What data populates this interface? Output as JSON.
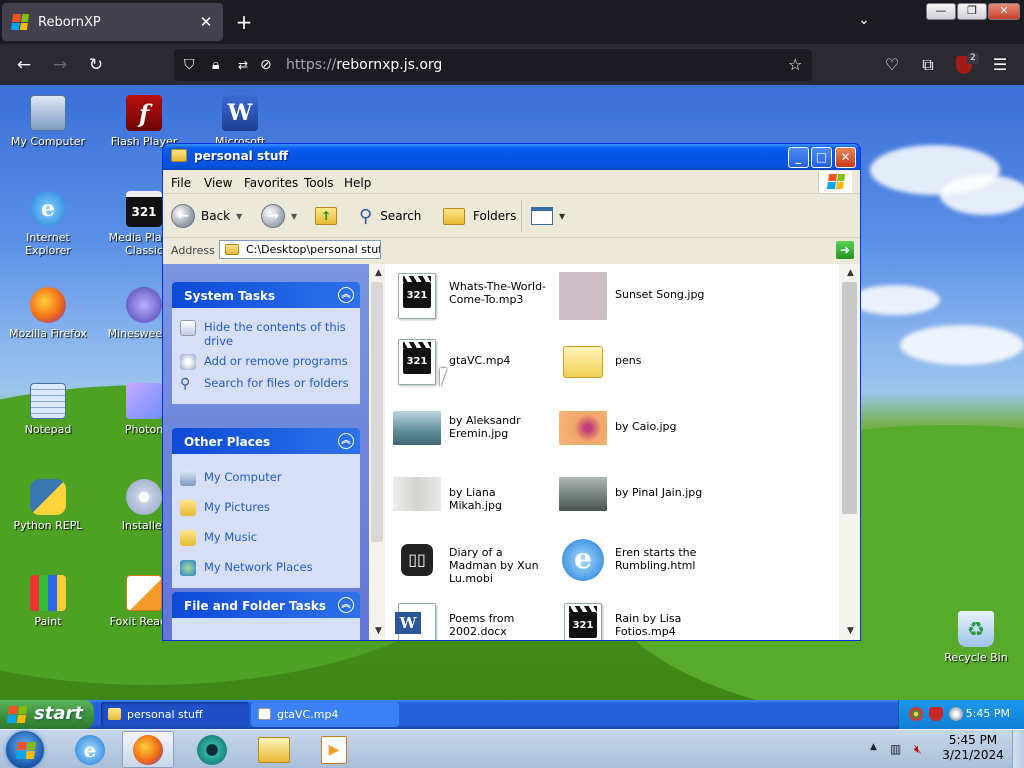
{
  "browser": {
    "tab_title": "RebornXP",
    "tab_close": "✕",
    "new_tab": "+",
    "tabs_list": "⌄",
    "window_controls": {
      "minimize": "—",
      "maximize": "❐",
      "close": "✕"
    },
    "url_protocol": "https://",
    "url_host": "rebornxp.js.org",
    "ublock_badge": "2",
    "icons": [
      "back-icon",
      "forward-icon",
      "reload-icon",
      "shield-icon",
      "lock-icon",
      "permissions-icon",
      "tracking-icon",
      "star-icon",
      "pocket-icon",
      "extensions-icon",
      "ublock-icon",
      "menu-icon"
    ]
  },
  "desktop": {
    "icons": [
      {
        "label": "My Computer",
        "icon": "computer-icon"
      },
      {
        "label": "Flash Player",
        "icon": "flash-icon"
      },
      {
        "label": "Microsoft",
        "icon": "word-icon"
      },
      {
        "label": "Internet Explorer",
        "icon": "ie-icon"
      },
      {
        "label": "Media Player Classic",
        "icon": "mpc-icon"
      },
      {
        "label": "Mozilla Firefox",
        "icon": "firefox-icon"
      },
      {
        "label": "Minesweeper",
        "icon": "mine-icon"
      },
      {
        "label": "Notepad",
        "icon": "notepad-icon"
      },
      {
        "label": "Photon",
        "icon": "photon-icon"
      },
      {
        "label": "Python REPL",
        "icon": "python-icon"
      },
      {
        "label": "Installer",
        "icon": "installer-icon"
      },
      {
        "label": "Paint",
        "icon": "paint-icon"
      },
      {
        "label": "Foxit Reader",
        "icon": "foxit-icon"
      },
      {
        "label": "Recycle Bin",
        "icon": "recycle-bin-icon"
      }
    ]
  },
  "explorer": {
    "title": "personal stuff",
    "menus": [
      "File",
      "View",
      "Favorites",
      "Tools",
      "Help"
    ],
    "toolbar": {
      "back": "Back",
      "search": "Search",
      "folders": "Folders"
    },
    "address_label": "Address",
    "address_value": "C:\\Desktop\\personal stuff",
    "tasks": {
      "system_title": "System Tasks",
      "system_items": [
        "Hide the contents of this drive",
        "Add or remove programs",
        "Search for files or folders"
      ],
      "other_title": "Other Places",
      "other_items": [
        "My Computer",
        "My Pictures",
        "My Music",
        "My Network Places"
      ],
      "file_title": "File and Folder Tasks"
    },
    "files": [
      {
        "name": "Whats-The-World-Come-To.mp3",
        "kind": "media"
      },
      {
        "name": "Sunset Song.jpg",
        "kind": "image",
        "color": "#cdbdc4"
      },
      {
        "name": "gtaVC.mp4",
        "kind": "media"
      },
      {
        "name": "pens",
        "kind": "folder"
      },
      {
        "name": "by Aleksandr Eremin.jpg",
        "kind": "image",
        "color": "#6f9aa6"
      },
      {
        "name": "by Caio.jpg",
        "kind": "image",
        "color": "#f0a060"
      },
      {
        "name": "by Liana Mikah.jpg",
        "kind": "image",
        "color": "#d9d9d6"
      },
      {
        "name": "by Pinal Jain.jpg",
        "kind": "image",
        "color": "#8b9694"
      },
      {
        "name": "Diary of a Madman by Xun Lu.mobi",
        "kind": "book"
      },
      {
        "name": "Eren starts the Rumbling.html",
        "kind": "ie"
      },
      {
        "name": "Poems from 2002.docx",
        "kind": "word"
      },
      {
        "name": "Rain by Lisa Fotios.mp4",
        "kind": "media"
      }
    ]
  },
  "xp_taskbar": {
    "start": "start",
    "tasks": [
      "personal stuff",
      "gtaVC.mp4"
    ],
    "clock": "5:45 PM"
  },
  "win7_taskbar": {
    "apps": [
      "ie-icon",
      "firefox-icon",
      "chrome-remote-icon",
      "explorer-icon",
      "media-icon"
    ],
    "time": "5:45 PM",
    "date": "3/21/2024",
    "tray_arrow": "▲"
  }
}
